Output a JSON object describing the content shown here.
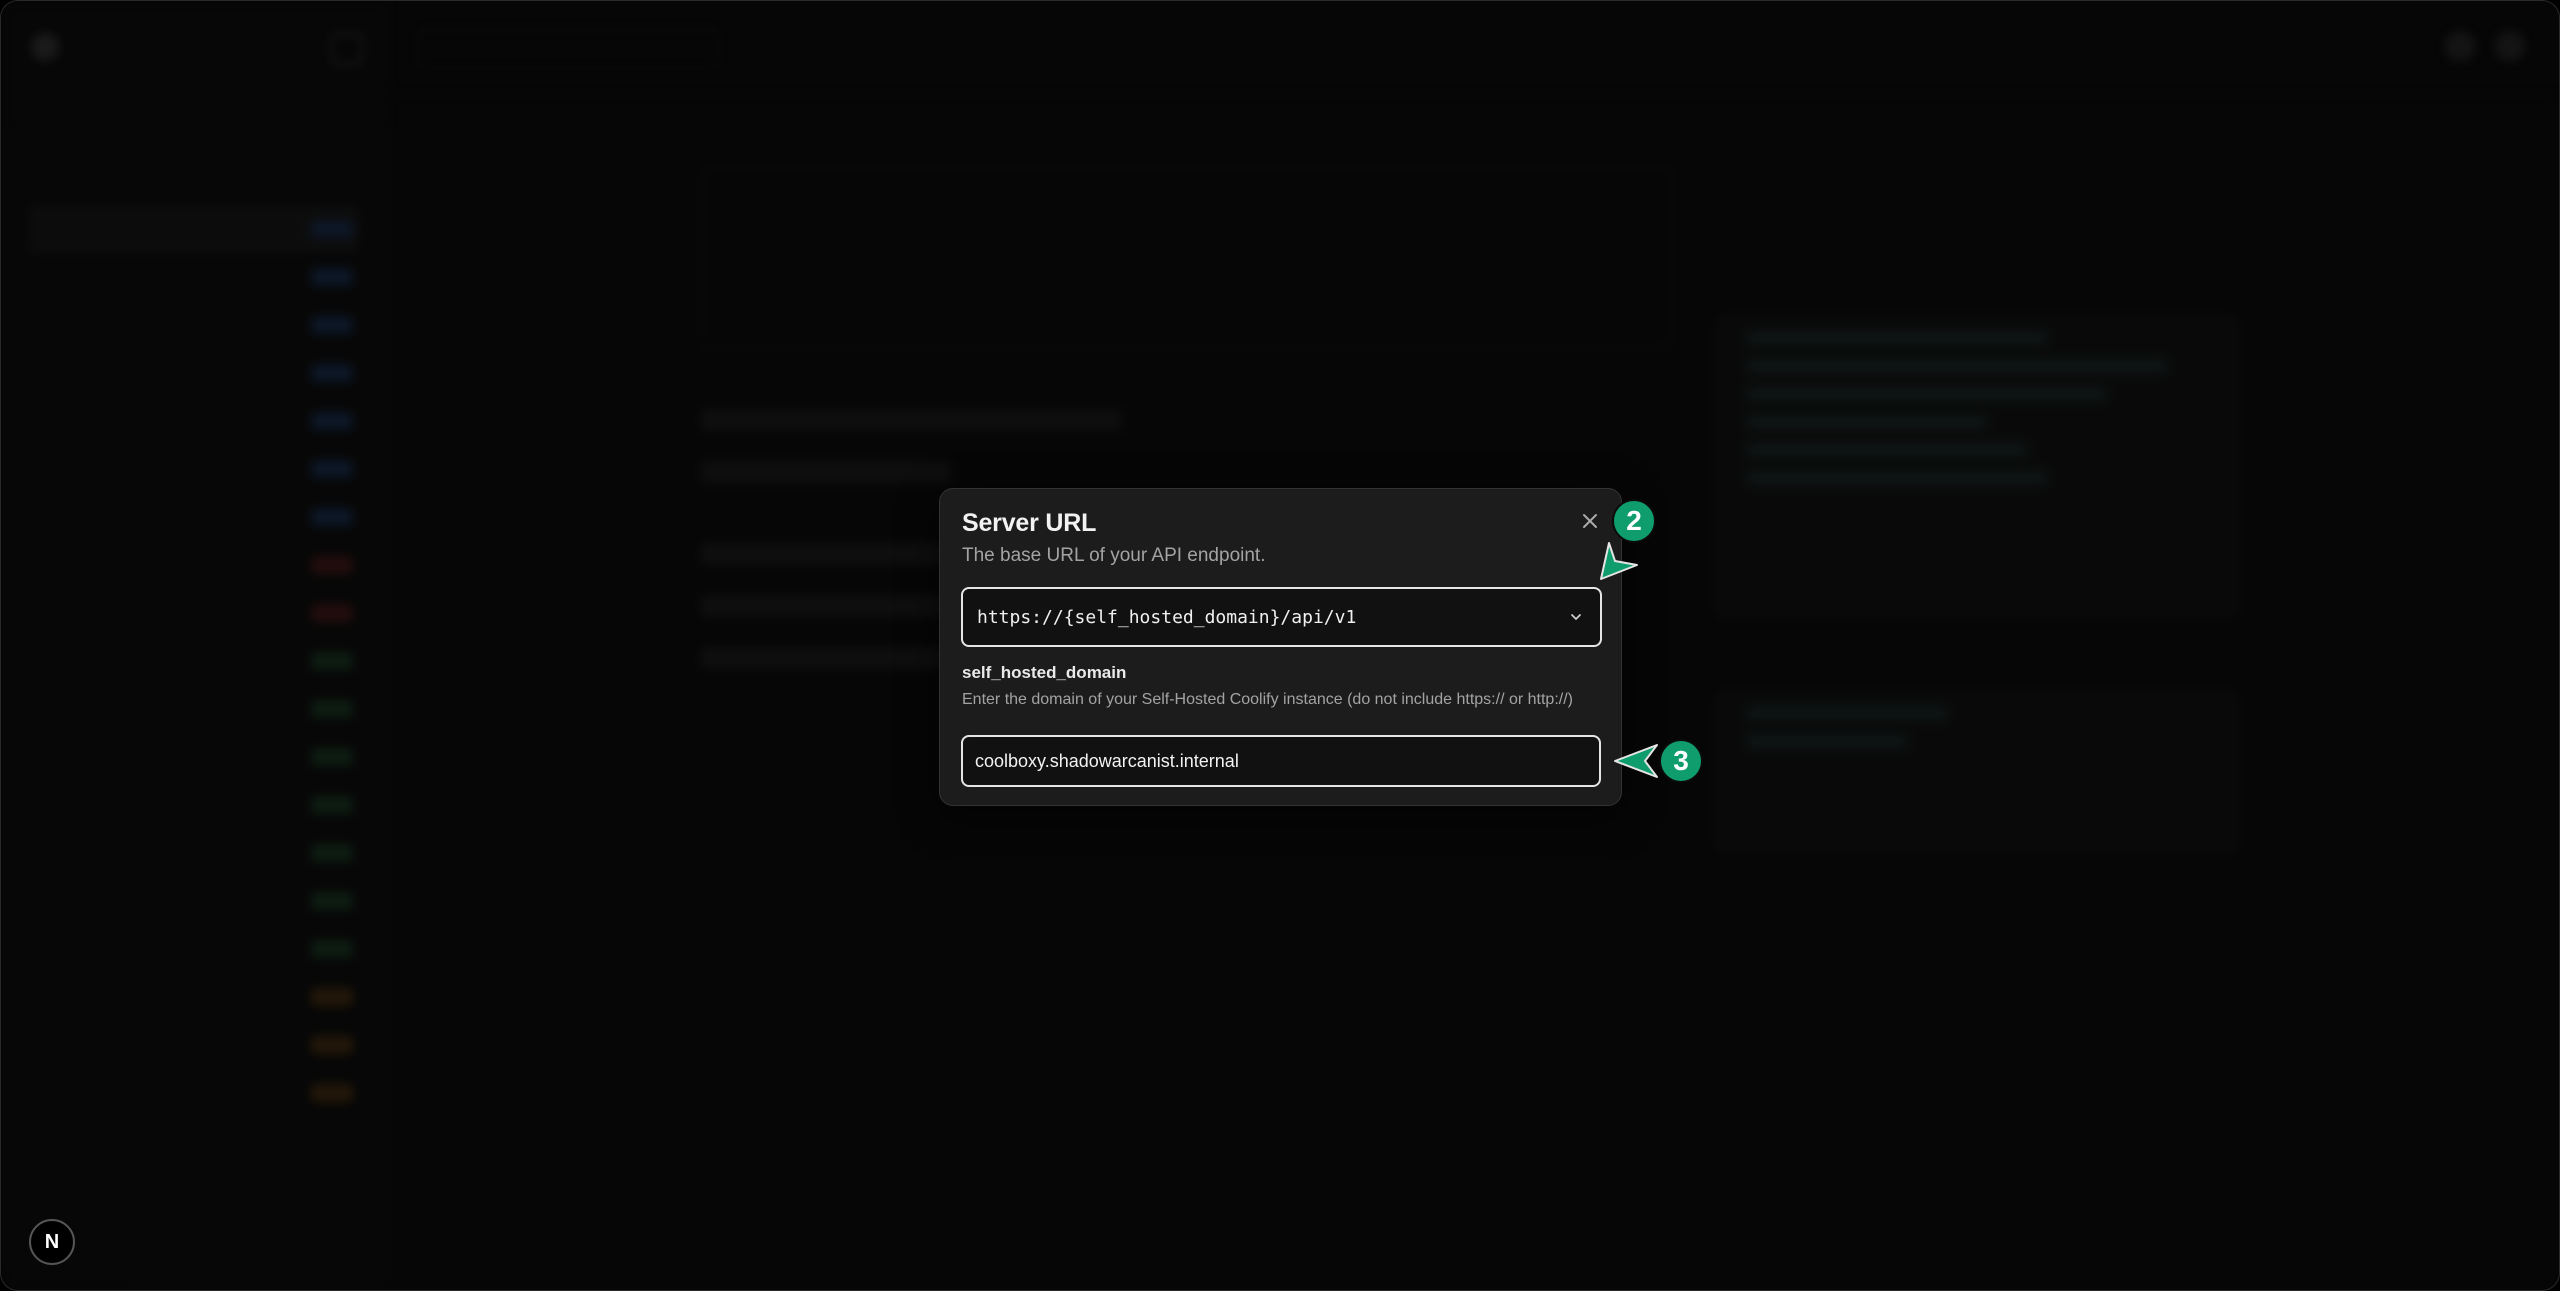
{
  "dialog": {
    "title": "Server URL",
    "subtitle": "The base URL of your API endpoint.",
    "close_icon": "close-icon",
    "server_url": "https://{self_hosted_domain}/api/v1",
    "variable": {
      "name": "self_hosted_domain",
      "description": "Enter the domain of your Self-Hosted Coolify instance (do not include https:// or http://)",
      "value": "coolboxy.shadowarcanist.internal"
    }
  },
  "annotations": {
    "step_2": "2",
    "step_3": "3",
    "accent_color": "#0f9d6e"
  },
  "corner_badge": {
    "label": "N"
  }
}
